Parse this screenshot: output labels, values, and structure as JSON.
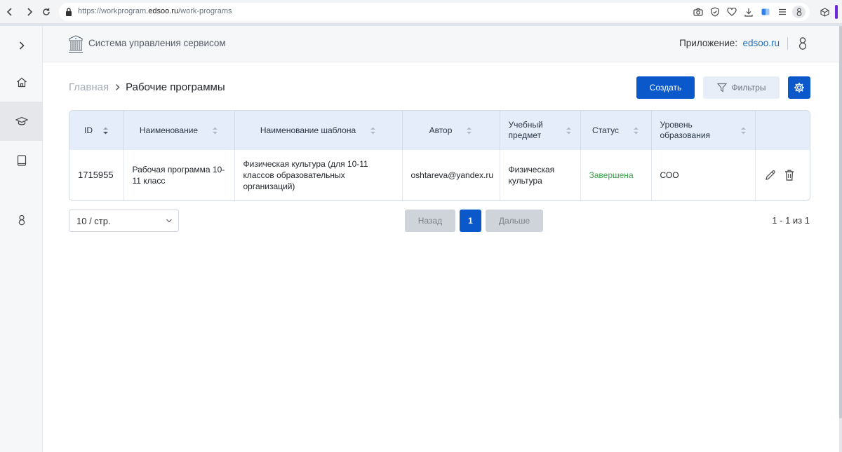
{
  "browser": {
    "url_prefix": "https://workprogram.",
    "url_domain": "edsoo.ru",
    "url_path": "/work-programs"
  },
  "header": {
    "title": "Система управления сервисом",
    "app_label": "Приложение:",
    "app_link": "edsoo.ru"
  },
  "breadcrumb": {
    "home": "Главная",
    "current": "Рабочие программы"
  },
  "toolbar": {
    "create_label": "Создать",
    "filters_label": "Фильтры"
  },
  "table": {
    "columns": {
      "id": "ID",
      "name": "Наименование",
      "template": "Наименование шаблона",
      "author": "Автор",
      "subject": "Учебный предмет",
      "status": "Статус",
      "level": "Уровень образования"
    },
    "rows": [
      {
        "id": "1715955",
        "name": "Рабочая программа 10-11 класс",
        "template": "Физическая культура (для 10-11 классов образовательных организаций)",
        "author": "oshtareva@yandex.ru",
        "subject": "Физическая культура",
        "status": "Завершена",
        "level": "СОО"
      }
    ]
  },
  "pagination": {
    "page_size": "10 / стр.",
    "prev_label": "Назад",
    "current_page": "1",
    "next_label": "Дальше",
    "range": "1 - 1 из 1"
  },
  "colors": {
    "primary": "#0a58ca",
    "status_done": "#3aa14b",
    "link": "#1f6fc0"
  }
}
